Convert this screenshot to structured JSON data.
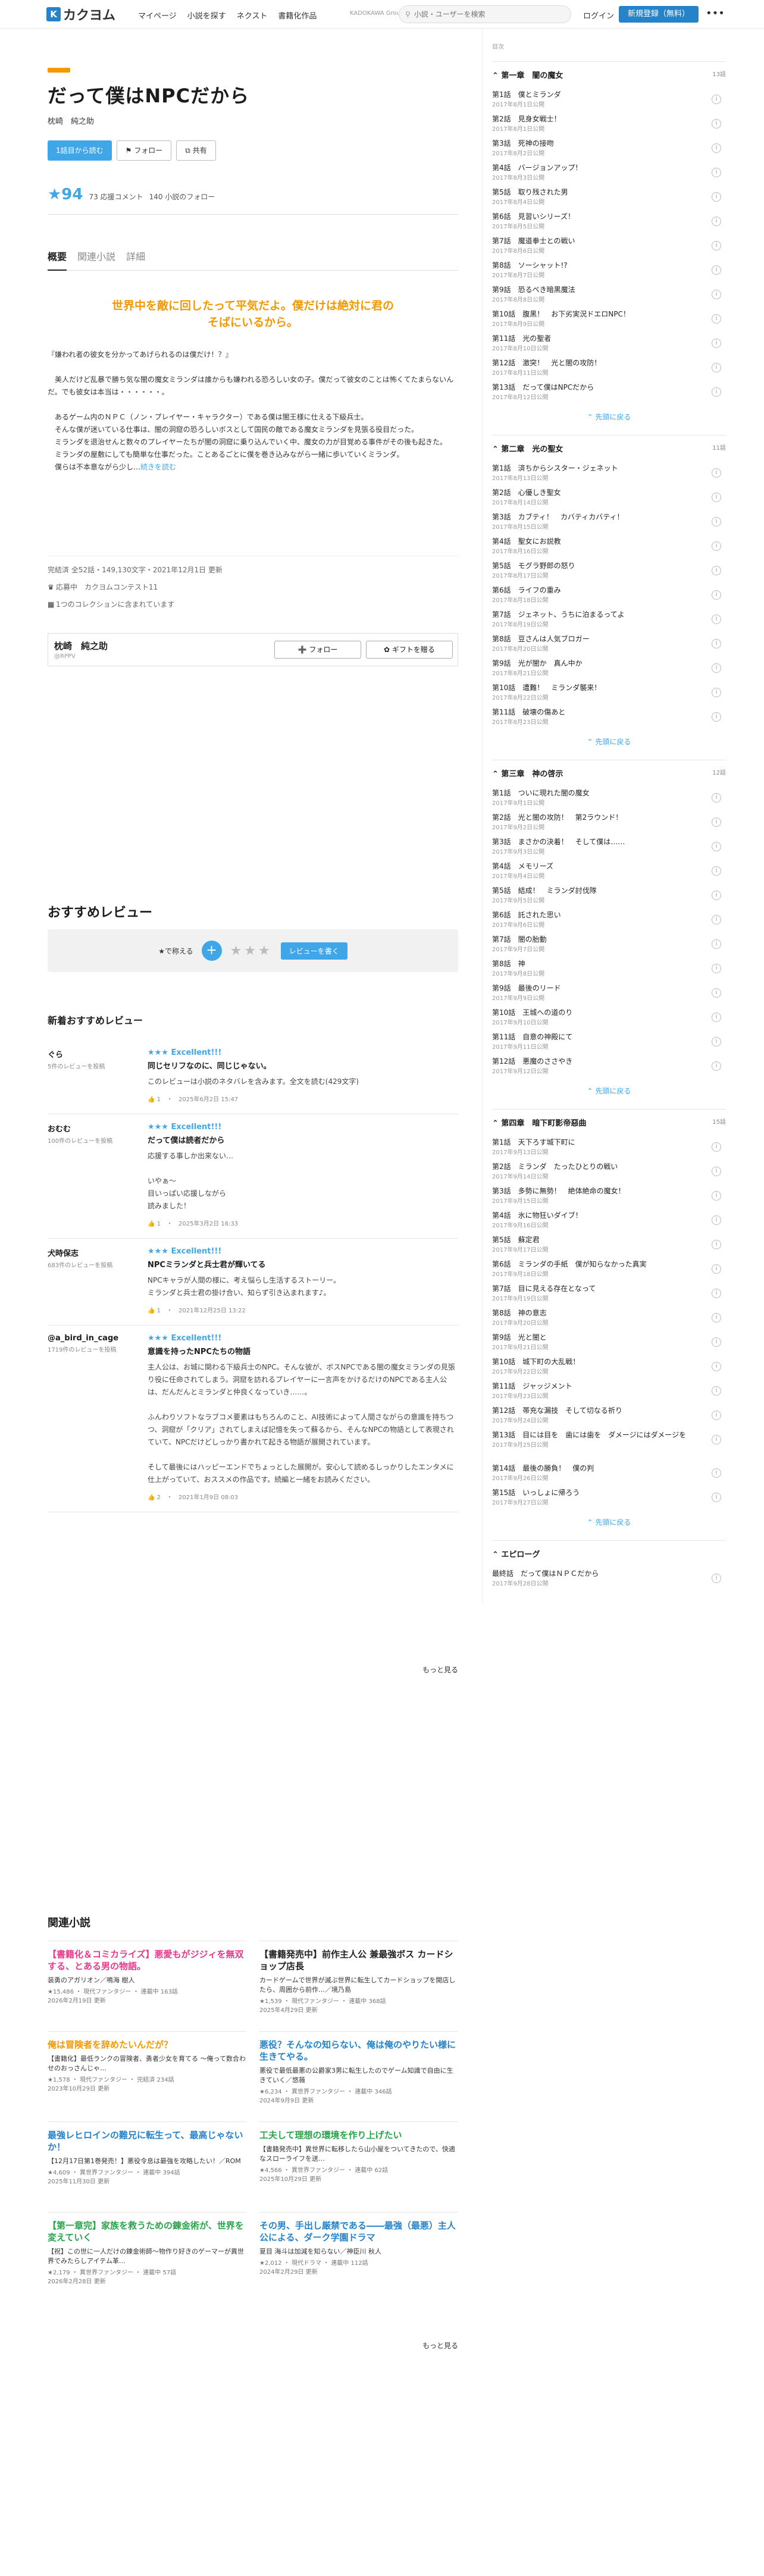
{
  "header": {
    "logo_mark": "K",
    "logo_text": "カクヨム",
    "nav": [
      "マイページ",
      "小説を探す",
      "ネクスト",
      "書籍化作品"
    ],
    "kadokawa": "KADOKAWA Group",
    "search_placeholder": "小説・ユーザーを検索",
    "login": "ログイン",
    "register": "新規登録（無料）",
    "more": "•••"
  },
  "work": {
    "title": "だって僕はNPCだから",
    "author": "枕崎　純之助",
    "read_button": "1話目から読む",
    "follow_button": "フォロー",
    "share_button": "共有",
    "rating": "★94",
    "review_comments": "73 応援コメント",
    "follows": "140 小説のフォロー",
    "tabs": [
      "概要",
      "関連小説",
      "詳細"
    ],
    "catch": "世界中を敵に回したって平気だよ。僕だけは絶対に君のそばにいるから。",
    "intro": "『嫌われ者の彼女を分かってあげられるのは僕だけ！？』\n\n　美人だけど乱暴で勝ち気な闇の魔女ミランダは誰からも嫌われる恐ろしい女の子。僕だって彼女のことは怖くてたまらないんだ。でも彼女は本当は・・・・・・。\n\n　あるゲーム内のＮＰＣ（ノン・プレイヤー・キャラクター）である僕は闇王様に仕える下級兵士。\n　そんな僕が迷いている仕事は、闇の洞窟の恐ろしいボスとして国民の敵である魔女ミランダを見張る役目だった。\n　ミランダを退治せんと数々のプレイヤーたちが闇の洞窟に乗り込んでいく中、魔女の力が目覚める事件がその後も起きた。\n　ミランダの屋敷にしても簡単な仕事だった。ことあるごとに僕を巻き込みながら一緒に歩いていくミランダ。\n　僕らは不本意ながら少し…",
    "intro_more": "続きを読む",
    "meta_line": "完結済 全52話・149,130文字・2021年12月1日 更新",
    "contest": "応募中　カクヨムコンテスト11",
    "collections": "1つのコレクションに含まれています",
    "authorbox_name": "枕崎　純之助",
    "authorbox_sub": "@RPPV",
    "authorbox_follow": "フォロー",
    "authorbox_gift": "ギフトを贈る"
  },
  "reviews": {
    "section_title": "おすすめレビュー",
    "rate_label": "★で称える",
    "rate_stars": "★★★",
    "rate_write": "レビューを書く",
    "new_title": "新着おすすめレビュー",
    "items": [
      {
        "name": "ぐら",
        "count": "5件のレビューを投稿",
        "stars": "★★★ Excellent!!!",
        "head": "同じセリフなのに、同じじゃない。",
        "body": "このレビューは小説のネタバレを含みます。全文を読む(429文字)",
        "foot": "👍 1　・　2025年6月2日 15:47"
      },
      {
        "name": "おむむ",
        "count": "100件のレビューを投稿",
        "stars": "★★★ Excellent!!!",
        "head": "だって僕は読者だから",
        "body": "応援する事しか出来ない…\n\nいやぁ〜\n目いっぱい応援しながら\n読みました！",
        "foot": "👍 1　・　2025年3月2日 16:33"
      },
      {
        "name": "犬時保志",
        "count": "683件のレビューを投稿",
        "stars": "★★★ Excellent!!!",
        "head": "NPCミランダと兵士君が輝いてる",
        "body": "NPCキャラが人間の様に、考え悩らし生活するストーリー。\nミランダと兵士君の掛け合い、知らず引き込まれます♪。",
        "foot": "👍 1　・　2021年12月25日 13:22"
      },
      {
        "name": "@a_bird_in_cage",
        "count": "1719件のレビューを投稿",
        "stars": "★★★ Excellent!!!",
        "head": "意識を持ったNPCたちの物語",
        "body": "主人公は、お城に関わる下級兵士のNPC。そんな彼が、ボスNPCである闇の魔女ミランダの見張り役に任命されてしまう。洞窟を訪れるプレイヤーに一言声をかけるだけのNPCである主人公は、だんだんとミランダと仲良くなっていき……。\n\nふんわりソフトなラブコメ要素はもちろんのこと、AI技術によって人間さながらの意識を持ちつつ、洞窟が「クリア」されてしまえば記憶を失って蘇るから、そんなNPCの物語として表現されていて、NPCだけどしっかり書かれて起きる物語が展開されています。\n\nそして最後にはハッピーエンドでちょっとした展開が。安心して読めるしっかりしたエンタメに仕上がっていて、おススメの作品です。続編と一緒をお読みください。",
        "foot": "👍 2　・　2021年1月9日 08:03"
      }
    ],
    "more": "もっと見る"
  },
  "related": {
    "title": "関連小説",
    "items": [
      {
        "title": "【書籍化＆コミカライズ】悪愛もがジジィを無双する、とある男の物語。",
        "color": "#e8398b",
        "sub": "装勇のアガリオン／鳴海 樹人",
        "meta": "★15,486 ・ 現代ファンタジー ・ 連載中 163話\n2026年2月19日 更新"
      },
      {
        "title": "【書籍発売中】前作主人公 兼最強ボス カードショップ店長",
        "color": "#222222",
        "sub": "カードゲームで世界が滅ぶ世界に転生してカードショップを開店したら、周囲から前作…／境乃島",
        "meta": "★1,539 ・ 現代ファンタジー ・ 連載中 368話\n2025年4月29日 更新"
      },
      {
        "title": "俺は冒険者を辞めたいんだが？",
        "color": "#f39800",
        "sub": "【書籍化】最低ランクの冒険者、勇者少女を育てる 〜俺って数合わせのおっさんじゃ…",
        "meta": "★1,578 ・ 現代ファンタジー ・ 完結済 234話\n2023年10月29日 更新"
      },
      {
        "title": "悪役？そんなの知らない、俺は俺のやりたい様に生きてやる。",
        "color": "#2683ca",
        "sub": "悪役で最低最悪の公爵家3男に転生したのでゲーム知識で自由に生きていく／悠薇",
        "meta": "★6,234 ・ 異世界ファンタジー ・ 連載中 346話\n2024年9月9日 更新"
      },
      {
        "title": "最強レヒロインの難兄に転生って、最高じゃないか！",
        "color": "#2683ca",
        "sub": "【12月17日第1巻発売！】悪役令息は最強を攻略したい！／ROM",
        "meta": "★4,609 ・ 異世界ファンタジー ・ 連載中 394話\n2025年11月30日 更新"
      },
      {
        "title": "工夫して理想の環境を作り上げたい",
        "color": "#29a34a",
        "sub": "【書籍発売中】異世界に転移したら山小屋をついてきたので、快適なスローライフを送…",
        "meta": "★4,566 ・ 異世界ファンタジー ・ 連載中 62話\n2025年10月29日 更新"
      },
      {
        "title": "【第一章完】家族を救うための錬金術が、世界を変えていく",
        "color": "#29a34a",
        "sub": "【祝】この世に一人だけの錬金術師〜物作り好きのゲーマーが異世界でみたらしアイテム革…",
        "meta": "★2,179 ・ 異世界ファンタジー ・ 連載中 57話\n2026年2月28日 更新"
      },
      {
        "title": "その男、手出し厳禁である――最強（最悪）主人公による、ダーク学園ドラマ",
        "color": "#2683ca",
        "sub": "夏目 海斗は加減を知らない／神臣川 秋人",
        "meta": "★2,012 ・ 現代ドラマ ・ 連載中 112話\n2024年2月29日 更新"
      }
    ],
    "more": "もっと見る"
  },
  "sidebar": {
    "label": "目次",
    "collapse": "先頭に戻る",
    "volumes": [
      {
        "title": "第一章　闇の魔女",
        "count": "13話",
        "episodes": [
          [
            "第1話　僕とミランダ",
            "2017年8月1日公開"
          ],
          [
            "第2話　見身女戦士！",
            "2017年8月1日公開"
          ],
          [
            "第3話　死神の接吻",
            "2017年8月2日公開"
          ],
          [
            "第4話　バージョンアップ！",
            "2017年8月3日公開"
          ],
          [
            "第5話　取り残された男",
            "2017年8月4日公開"
          ],
          [
            "第6話　見習いシリーズ！",
            "2017年8月5日公開"
          ],
          [
            "第7話　魔道拳士との戦い",
            "2017年8月6日公開"
          ],
          [
            "第8話　ソーシャット!?",
            "2017年8月7日公開"
          ],
          [
            "第9話　恐るべき暗黒魔法",
            "2017年8月8日公開"
          ],
          [
            "第10話　腹黒！　お下劣実況ドエロNPC！",
            "2017年8月9日公開"
          ],
          [
            "第11話　光の聖者",
            "2017年8月10日公開"
          ],
          [
            "第12話　激突！　光と闇の攻防！",
            "2017年8月11日公開"
          ],
          [
            "第13話　だって僕はNPCだから",
            "2017年8月12日公開"
          ]
        ]
      },
      {
        "title": "第二章　光の聖女",
        "count": "11話",
        "episodes": [
          [
            "第1話　済ちからシスター・ジェネット",
            "2017年8月13日公開"
          ],
          [
            "第2話　心優しき聖女",
            "2017年8月14日公開"
          ],
          [
            "第3話　カブティ！　カバティカバティ！",
            "2017年8月15日公開"
          ],
          [
            "第4話　聖女にお説教",
            "2017年8月16日公開"
          ],
          [
            "第5話　モグラ野郎の怒り",
            "2017年8月17日公開"
          ],
          [
            "第6話　ライフの重み",
            "2017年8月18日公開"
          ],
          [
            "第7話　ジェネット、うちに泊まるってよ",
            "2017年8月19日公開"
          ],
          [
            "第8話　豆さんは人気ブロガー",
            "2017年8月20日公開"
          ],
          [
            "第9話　光が闇か　真ん中か",
            "2017年8月21日公開"
          ],
          [
            "第10話　遭難！　ミランダ襲来！",
            "2017年8月22日公開"
          ],
          [
            "第11話　破壊の傷あと",
            "2017年8月23日公開"
          ]
        ]
      },
      {
        "title": "第三章　神の啓示",
        "count": "12話",
        "episodes": [
          [
            "第1話　ついに現れた闇の魔女",
            "2017年9月1日公開"
          ],
          [
            "第2話　光と闇の攻防！　第2ラウンド！",
            "2017年9月2日公開"
          ],
          [
            "第3話　まさかの決着！　そして僕は……",
            "2017年9月3日公開"
          ],
          [
            "第4話　メモリーズ",
            "2017年9月4日公開"
          ],
          [
            "第5話　結成！　ミランダ討伐隊",
            "2017年9月5日公開"
          ],
          [
            "第6話　託された思い",
            "2017年9月6日公開"
          ],
          [
            "第7話　闇の胎動",
            "2017年9月7日公開"
          ],
          [
            "第8話　神",
            "2017年9月8日公開"
          ],
          [
            "第9話　最後のリード",
            "2017年9月9日公開"
          ],
          [
            "第10話　王城への道のり",
            "2017年9月10日公開"
          ],
          [
            "第11話　自意の神殿にて",
            "2017年9月11日公開"
          ],
          [
            "第12話　悪魔のささやき",
            "2017年9月12日公開"
          ]
        ]
      },
      {
        "title": "第四章　暗下町影帝惡曲",
        "count": "15話",
        "episodes": [
          [
            "第1話　天下ろす城下町に",
            "2017年9月13日公開"
          ],
          [
            "第2話　ミランダ　たったひとりの戦い",
            "2017年9月14日公開"
          ],
          [
            "第3話　多勢に無勢！　絶体絶命の魔女！",
            "2017年9月15日公開"
          ],
          [
            "第4話　氷に物狂いダイブ！",
            "2017年9月16日公開"
          ],
          [
            "第5話　蘇定君",
            "2017年9月17日公開"
          ],
          [
            "第6話　ミランダの手紙　僕が知らなかった真実",
            "2017年9月18日公開"
          ],
          [
            "第7話　目に見える存在となって",
            "2017年9月19日公開"
          ],
          [
            "第8話　神の意志",
            "2017年9月20日公開"
          ],
          [
            "第9話　光と闇と",
            "2017年9月21日公開"
          ],
          [
            "第10話　城下町の大乱戦！",
            "2017年9月22日公開"
          ],
          [
            "第11話　ジャッジメント",
            "2017年9月23日公開"
          ],
          [
            "第12話　帯充な漏技　そして切なる祈り",
            "2017年9月24日公開"
          ],
          [
            "第13話　目には目を　歯には歯を　ダメージにはダメージを",
            "2017年9月25日公開"
          ],
          [
            "第14話　最後の勝負！　僕の判",
            "2017年9月26日公開"
          ],
          [
            "第15話　いっしょに帰ろう",
            "2017年9月27日公開"
          ]
        ]
      },
      {
        "title": "エピローグ",
        "count": "",
        "episodes": [
          [
            "最終話　だって僕はＮＰＣだから",
            "2017年9月28日公開"
          ]
        ]
      }
    ]
  }
}
